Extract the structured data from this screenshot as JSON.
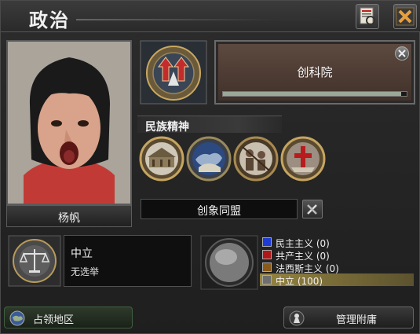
{
  "window": {
    "title": "政治"
  },
  "leader": {
    "name": "杨帆"
  },
  "research": {
    "label": "创科院",
    "progress": 0.97
  },
  "national_spirit": {
    "title": "民族精神",
    "spirits": [
      "spirit-building-icon",
      "spirit-globe-icon",
      "spirit-soldiers-icon",
      "spirit-red-cross-icon"
    ]
  },
  "faction": {
    "name": "创象同盟"
  },
  "ruling_party": {
    "name": "中立",
    "election_status": "无选举"
  },
  "popularity": {
    "items": [
      {
        "label": "民主主义 (0)",
        "value": 0,
        "color": "#1f3bd6"
      },
      {
        "label": "共产主义 (0)",
        "value": 0,
        "color": "#b01818"
      },
      {
        "label": "法西斯主义 (0)",
        "value": 0,
        "color": "#8a5a1a"
      },
      {
        "label": "中立 (100)",
        "value": 100,
        "color": "#6e6e6e"
      }
    ]
  },
  "footer": {
    "occupied_label": "占领地区",
    "subjects_label": "管理附庸"
  }
}
